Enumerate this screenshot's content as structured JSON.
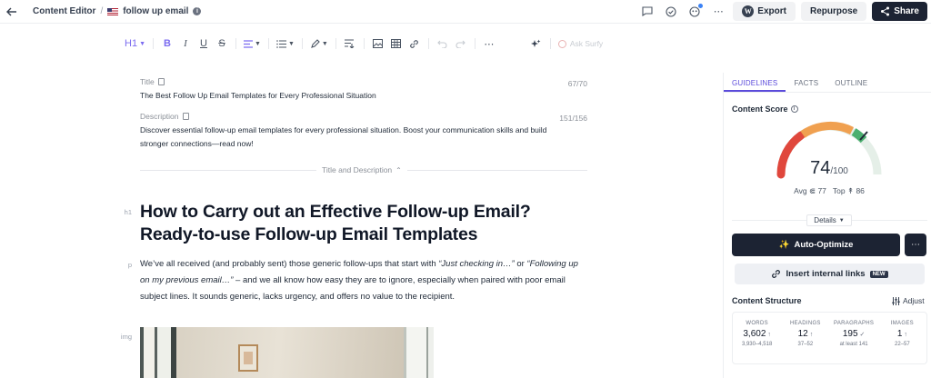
{
  "topbar": {
    "breadcrumb_root": "Content Editor",
    "breadcrumb_sep": "/",
    "doc_name": "follow up email",
    "export_label": "Export",
    "repurpose_label": "Repurpose",
    "share_label": "Share"
  },
  "toolbar": {
    "heading_label": "H1",
    "ask_surfy_label": "Ask Surfy"
  },
  "editor": {
    "title_label": "Title",
    "title_count": "67/70",
    "title_text": "The Best Follow Up Email Templates for Every Professional Situation",
    "description_label": "Description",
    "description_count": "151/156",
    "description_text": "Discover essential follow-up email templates for every professional situation. Boost your communication skills and build stronger connections—read now!",
    "collapse_label": "Title and Description",
    "h1_tag": "h1",
    "h1_line1": "How to Carry out an Effective Follow-up Email?",
    "h1_line2": "Ready-to-use Follow-up Email Templates",
    "p_tag": "p",
    "para_start": "We’ve all received (and probably sent) those generic follow-ups that start with ",
    "para_quote1": "“Just checking in…”",
    "para_mid": " or ",
    "para_quote2": "“Following up on my previous email…”",
    "para_end": " – and we all know how easy they are to ignore, especially when paired with poor email subject lines. It sounds generic, lacks urgency, and offers no value to the recipient.",
    "img_tag": "img"
  },
  "panel": {
    "tabs": [
      "GUIDELINES",
      "FACTS",
      "OUTLINE"
    ],
    "score_title": "Content Score",
    "score": "74",
    "score_max": "/100",
    "score_value": 74,
    "avg_label": "Avg",
    "avg_value": "77",
    "top_label": "Top",
    "top_value": "86",
    "details_label": "Details",
    "auto_optimize_label": "Auto-Optimize",
    "more_label": "⋯",
    "internal_links_label": "Insert internal links",
    "new_badge": "NEW",
    "structure_title": "Content Structure",
    "adjust_label": "Adjust",
    "stats": [
      {
        "label": "WORDS",
        "value": "3,602",
        "arrow": "↑",
        "range": "3,930–4,518"
      },
      {
        "label": "HEADINGS",
        "value": "12",
        "arrow": "↑",
        "range": "37–52"
      },
      {
        "label": "PARAGRAPHS",
        "value": "195",
        "arrow": "✓",
        "range": "at least 141"
      },
      {
        "label": "IMAGES",
        "value": "1",
        "arrow": "↑",
        "range": "22–57"
      }
    ]
  },
  "colors": {
    "accent": "#5b4bdb",
    "dark_button": "#1c2333",
    "gauge_red": "#e0473c",
    "gauge_orange": "#f0a050",
    "gauge_green": "#4caf70"
  }
}
